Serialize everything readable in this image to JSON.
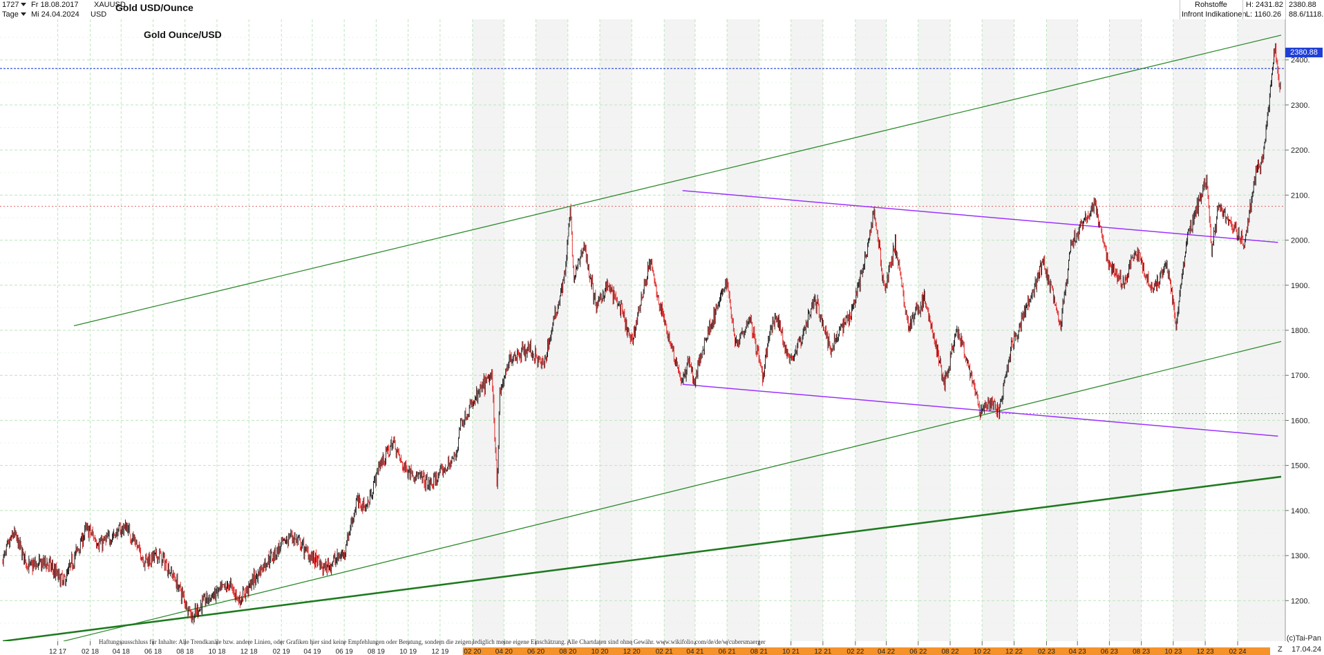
{
  "header": {
    "count": "1727",
    "start_date": "Fr 18.08.2017",
    "symbol": "XAUUSD",
    "period": "Tage",
    "end_date": "Mi 24.04.2024",
    "currency": "USD",
    "title": "Gold USD/Ounce",
    "category": "Rohstoffe",
    "source": "Infront Indikationen",
    "high": "H: 2431.82",
    "low": "L: 1160.26",
    "last": "2380.88",
    "change": "88.6/1118."
  },
  "chart_data": {
    "type": "candlestick",
    "title": "Gold Ounce/USD",
    "ylim": [
      1110,
      2490
    ],
    "yticks": [
      1200,
      1300,
      1400,
      1500,
      1600,
      1700,
      1800,
      1900,
      2000,
      2100,
      2200,
      2300,
      2400
    ],
    "ytick_labels": [
      "1200.",
      "1300.",
      "1400.",
      "1500.",
      "1600.",
      "1700.",
      "1800.",
      "1900.",
      "2000.",
      "2100.",
      "2200.",
      "2300.",
      "2400."
    ],
    "xtick_labels": [
      "12 17",
      "02 18",
      "04 18",
      "06 18",
      "08 18",
      "10 18",
      "12 18",
      "02 19",
      "04 19",
      "06 19",
      "08 19",
      "10 19",
      "12 19",
      "02 20",
      "04 20",
      "06 20",
      "08 20",
      "10 20",
      "12 20",
      "02 21",
      "04 21",
      "06 21",
      "08 21",
      "10 21",
      "12 21",
      "02 22",
      "04 22",
      "06 22",
      "08 22",
      "10 22",
      "12 22",
      "02 23",
      "04 23",
      "06 23",
      "08 23",
      "10 23",
      "12 23",
      "02 24"
    ],
    "highlight_from_label": "02 20",
    "last_price": 2380.88,
    "last_price_label": "2380.88",
    "reference_level_red": 2075,
    "reference_level_green": 1615,
    "grid": true,
    "price_path": [
      [
        "2017-08-18",
        1290
      ],
      [
        "2017-09-08",
        1350
      ],
      [
        "2017-10-06",
        1275
      ],
      [
        "2017-11-10",
        1285
      ],
      [
        "2017-12-12",
        1240
      ],
      [
        "2018-01-25",
        1360
      ],
      [
        "2018-02-20",
        1325
      ],
      [
        "2018-04-11",
        1365
      ],
      [
        "2018-05-15",
        1290
      ],
      [
        "2018-06-14",
        1300
      ],
      [
        "2018-07-10",
        1255
      ],
      [
        "2018-08-16",
        1162
      ],
      [
        "2018-09-05",
        1198
      ],
      [
        "2018-10-26",
        1235
      ],
      [
        "2018-11-13",
        1200
      ],
      [
        "2018-12-31",
        1282
      ],
      [
        "2019-02-20",
        1345
      ],
      [
        "2019-03-20",
        1310
      ],
      [
        "2019-04-23",
        1270
      ],
      [
        "2019-05-31",
        1305
      ],
      [
        "2019-06-25",
        1420
      ],
      [
        "2019-07-15",
        1410
      ],
      [
        "2019-08-07",
        1500
      ],
      [
        "2019-09-04",
        1552
      ],
      [
        "2019-09-20",
        1500
      ],
      [
        "2019-11-12",
        1455
      ],
      [
        "2019-12-31",
        1520
      ],
      [
        "2020-01-08",
        1590
      ],
      [
        "2020-02-24",
        1680
      ],
      [
        "2020-03-09",
        1700
      ],
      [
        "2020-03-19",
        1460
      ],
      [
        "2020-03-24",
        1660
      ],
      [
        "2020-04-14",
        1740
      ],
      [
        "2020-05-18",
        1760
      ],
      [
        "2020-06-15",
        1720
      ],
      [
        "2020-07-27",
        1930
      ],
      [
        "2020-08-06",
        2070
      ],
      [
        "2020-08-12",
        1910
      ],
      [
        "2020-09-01",
        1990
      ],
      [
        "2020-09-24",
        1850
      ],
      [
        "2020-10-15",
        1900
      ],
      [
        "2020-11-09",
        1850
      ],
      [
        "2020-11-30",
        1770
      ],
      [
        "2021-01-05",
        1955
      ],
      [
        "2021-01-20",
        1870
      ],
      [
        "2021-03-08",
        1680
      ],
      [
        "2021-03-20",
        1740
      ],
      [
        "2021-03-30",
        1680
      ],
      [
        "2021-04-20",
        1780
      ],
      [
        "2021-05-10",
        1840
      ],
      [
        "2021-06-01",
        1910
      ],
      [
        "2021-06-17",
        1770
      ],
      [
        "2021-07-15",
        1830
      ],
      [
        "2021-08-09",
        1690
      ],
      [
        "2021-08-20",
        1790
      ],
      [
        "2021-09-03",
        1830
      ],
      [
        "2021-09-29",
        1730
      ],
      [
        "2021-10-20",
        1780
      ],
      [
        "2021-11-16",
        1870
      ],
      [
        "2021-12-15",
        1760
      ],
      [
        "2022-01-25",
        1845
      ],
      [
        "2022-02-24",
        1975
      ],
      [
        "2022-03-08",
        2070
      ],
      [
        "2022-03-29",
        1890
      ],
      [
        "2022-04-18",
        1990
      ],
      [
        "2022-05-13",
        1810
      ],
      [
        "2022-06-13",
        1870
      ],
      [
        "2022-07-21",
        1680
      ],
      [
        "2022-08-15",
        1800
      ],
      [
        "2022-09-28",
        1620
      ],
      [
        "2022-10-21",
        1640
      ],
      [
        "2022-11-03",
        1620
      ],
      [
        "2022-11-25",
        1760
      ],
      [
        "2023-01-26",
        1950
      ],
      [
        "2023-02-28",
        1810
      ],
      [
        "2023-03-20",
        1990
      ],
      [
        "2023-04-13",
        2040
      ],
      [
        "2023-05-04",
        2080
      ],
      [
        "2023-05-30",
        1950
      ],
      [
        "2023-06-29",
        1900
      ],
      [
        "2023-07-20",
        1980
      ],
      [
        "2023-08-21",
        1890
      ],
      [
        "2023-09-20",
        1945
      ],
      [
        "2023-10-06",
        1815
      ],
      [
        "2023-10-27",
        2000
      ],
      [
        "2023-12-04",
        2140
      ],
      [
        "2023-12-13",
        1980
      ],
      [
        "2023-12-27",
        2080
      ],
      [
        "2024-02-14",
        1990
      ],
      [
        "2024-03-05",
        2140
      ],
      [
        "2024-03-21",
        2190
      ],
      [
        "2024-04-12",
        2431
      ],
      [
        "2024-04-22",
        2325
      ],
      [
        "2024-04-24",
        2381
      ]
    ],
    "trend_lines": [
      {
        "color": "#2e8b2e",
        "width": 1.3,
        "points": [
          [
            "2018-01-01",
            1810
          ],
          [
            "2024-04-24",
            2455
          ]
        ]
      },
      {
        "color": "#2e8b2e",
        "width": 1.3,
        "points": [
          [
            "2017-12-12",
            1110
          ],
          [
            "2024-04-24",
            1775
          ]
        ]
      },
      {
        "color": "#1f7a1f",
        "width": 2.6,
        "points": [
          [
            "2017-08-18",
            1110
          ],
          [
            "2024-04-24",
            1475
          ]
        ]
      },
      {
        "color": "#9b30ff",
        "width": 1.5,
        "points": [
          [
            "2021-03-08",
            2110
          ],
          [
            "2024-04-18",
            1995
          ]
        ]
      },
      {
        "color": "#9b30ff",
        "width": 1.5,
        "points": [
          [
            "2021-03-08",
            1680
          ],
          [
            "2024-04-18",
            1565
          ]
        ]
      }
    ]
  },
  "footer": {
    "disclaimer": "Haftungsausschluss für Inhalte: Alle Trendkanäle bzw. andere Linien, oder Grafiken hier sind keine Empfehlungen oder Beratung, sondern die zeigen lediglich meine eigene Einschätzung. Alle Chartdaten sind ohne Gewähr. www.wikifolio.com/de/de/w/cubersmaerger",
    "copyright": "(c)Tai-Pan",
    "end_label": "17.04.24",
    "zoom_label": "Z"
  }
}
